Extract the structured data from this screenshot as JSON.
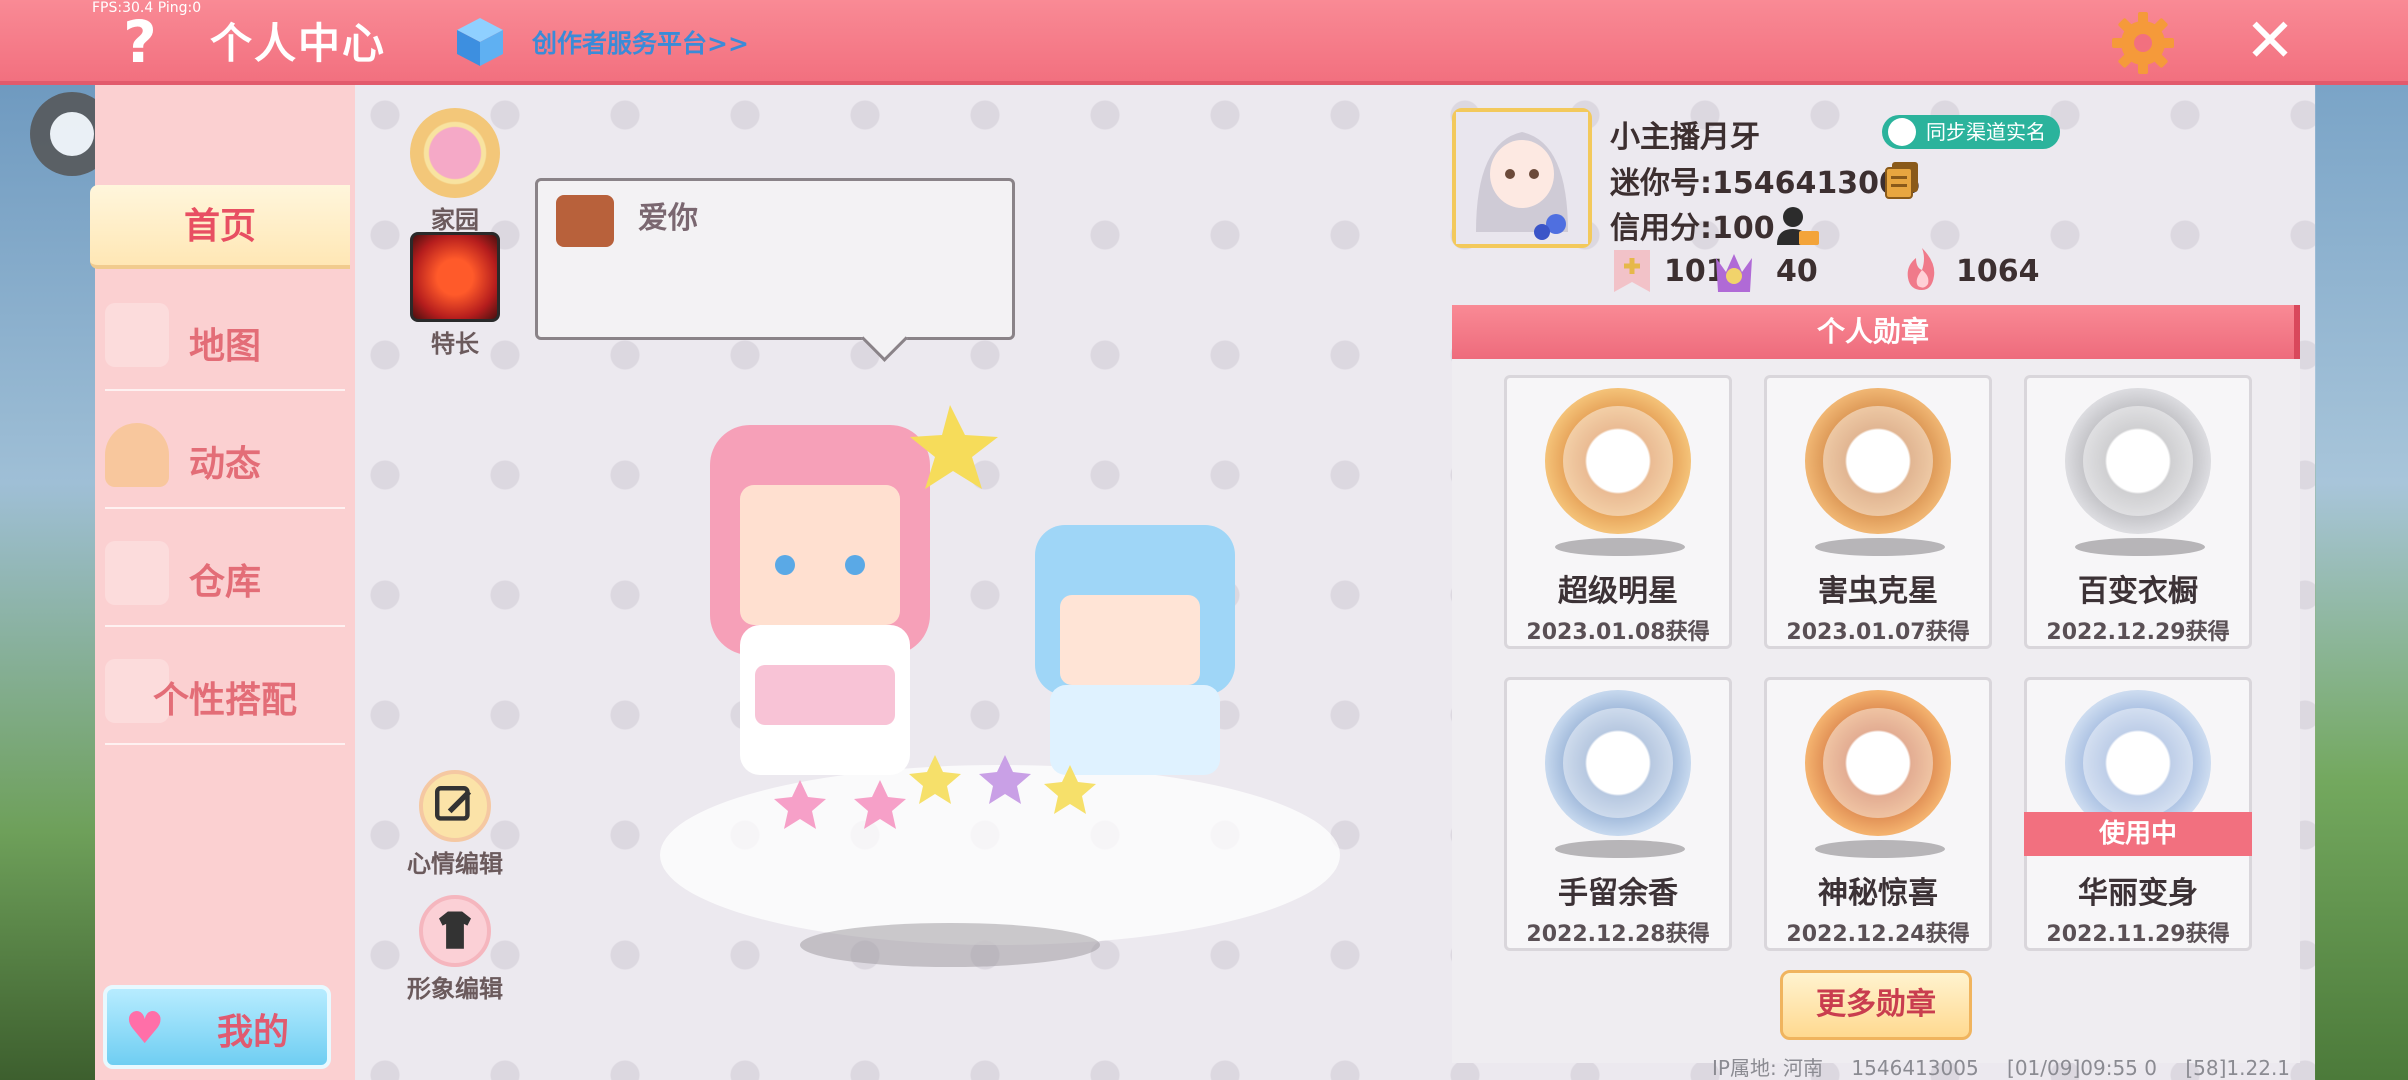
{
  "status": {
    "fps": "FPS:30.4  Ping:0"
  },
  "header": {
    "title": "个人中心",
    "creator_link": "创作者服务平台>>"
  },
  "sidebar": {
    "items": [
      {
        "label": "首页"
      },
      {
        "label": "地图"
      },
      {
        "label": "动态"
      },
      {
        "label": "仓库"
      },
      {
        "label": "个性搭配"
      }
    ],
    "mine_label": "我的"
  },
  "home_icons": {
    "home": "家园",
    "talent": "特长",
    "mood_edit": "心情编辑",
    "look_edit": "形象编辑"
  },
  "mood": {
    "text": "爱你"
  },
  "profile": {
    "name": "小主播月牙",
    "sync_badge": "同步渠道实名",
    "mini_id": "迷你号:1546413005",
    "credit": "信用分:100",
    "stats": {
      "likes": "101",
      "fans": "40",
      "heat": "1064"
    }
  },
  "badges": {
    "title": "个人勋章",
    "items": [
      {
        "name": "超级明星",
        "date": "2023.01.08获得",
        "color": "#d9843c"
      },
      {
        "name": "害虫克星",
        "date": "2023.01.07获得",
        "color": "#c97a3a"
      },
      {
        "name": "百变衣橱",
        "date": "2022.12.29获得",
        "color": "#a9a9ad"
      },
      {
        "name": "手留余香",
        "date": "2022.12.28获得",
        "color": "#7d9cc8"
      },
      {
        "name": "神秘惊喜",
        "date": "2022.12.24获得",
        "color": "#cc6a3a"
      },
      {
        "name": "华丽变身",
        "date": "2022.11.29获得",
        "color": "#8aa7d6",
        "in_use": "使用中"
      }
    ],
    "more_label": "更多勋章"
  },
  "footer": {
    "ip": "IP属地: 河南",
    "uid": "1546413005",
    "time": "[01/09]09:55 0",
    "version": "[58]1.22.1"
  }
}
